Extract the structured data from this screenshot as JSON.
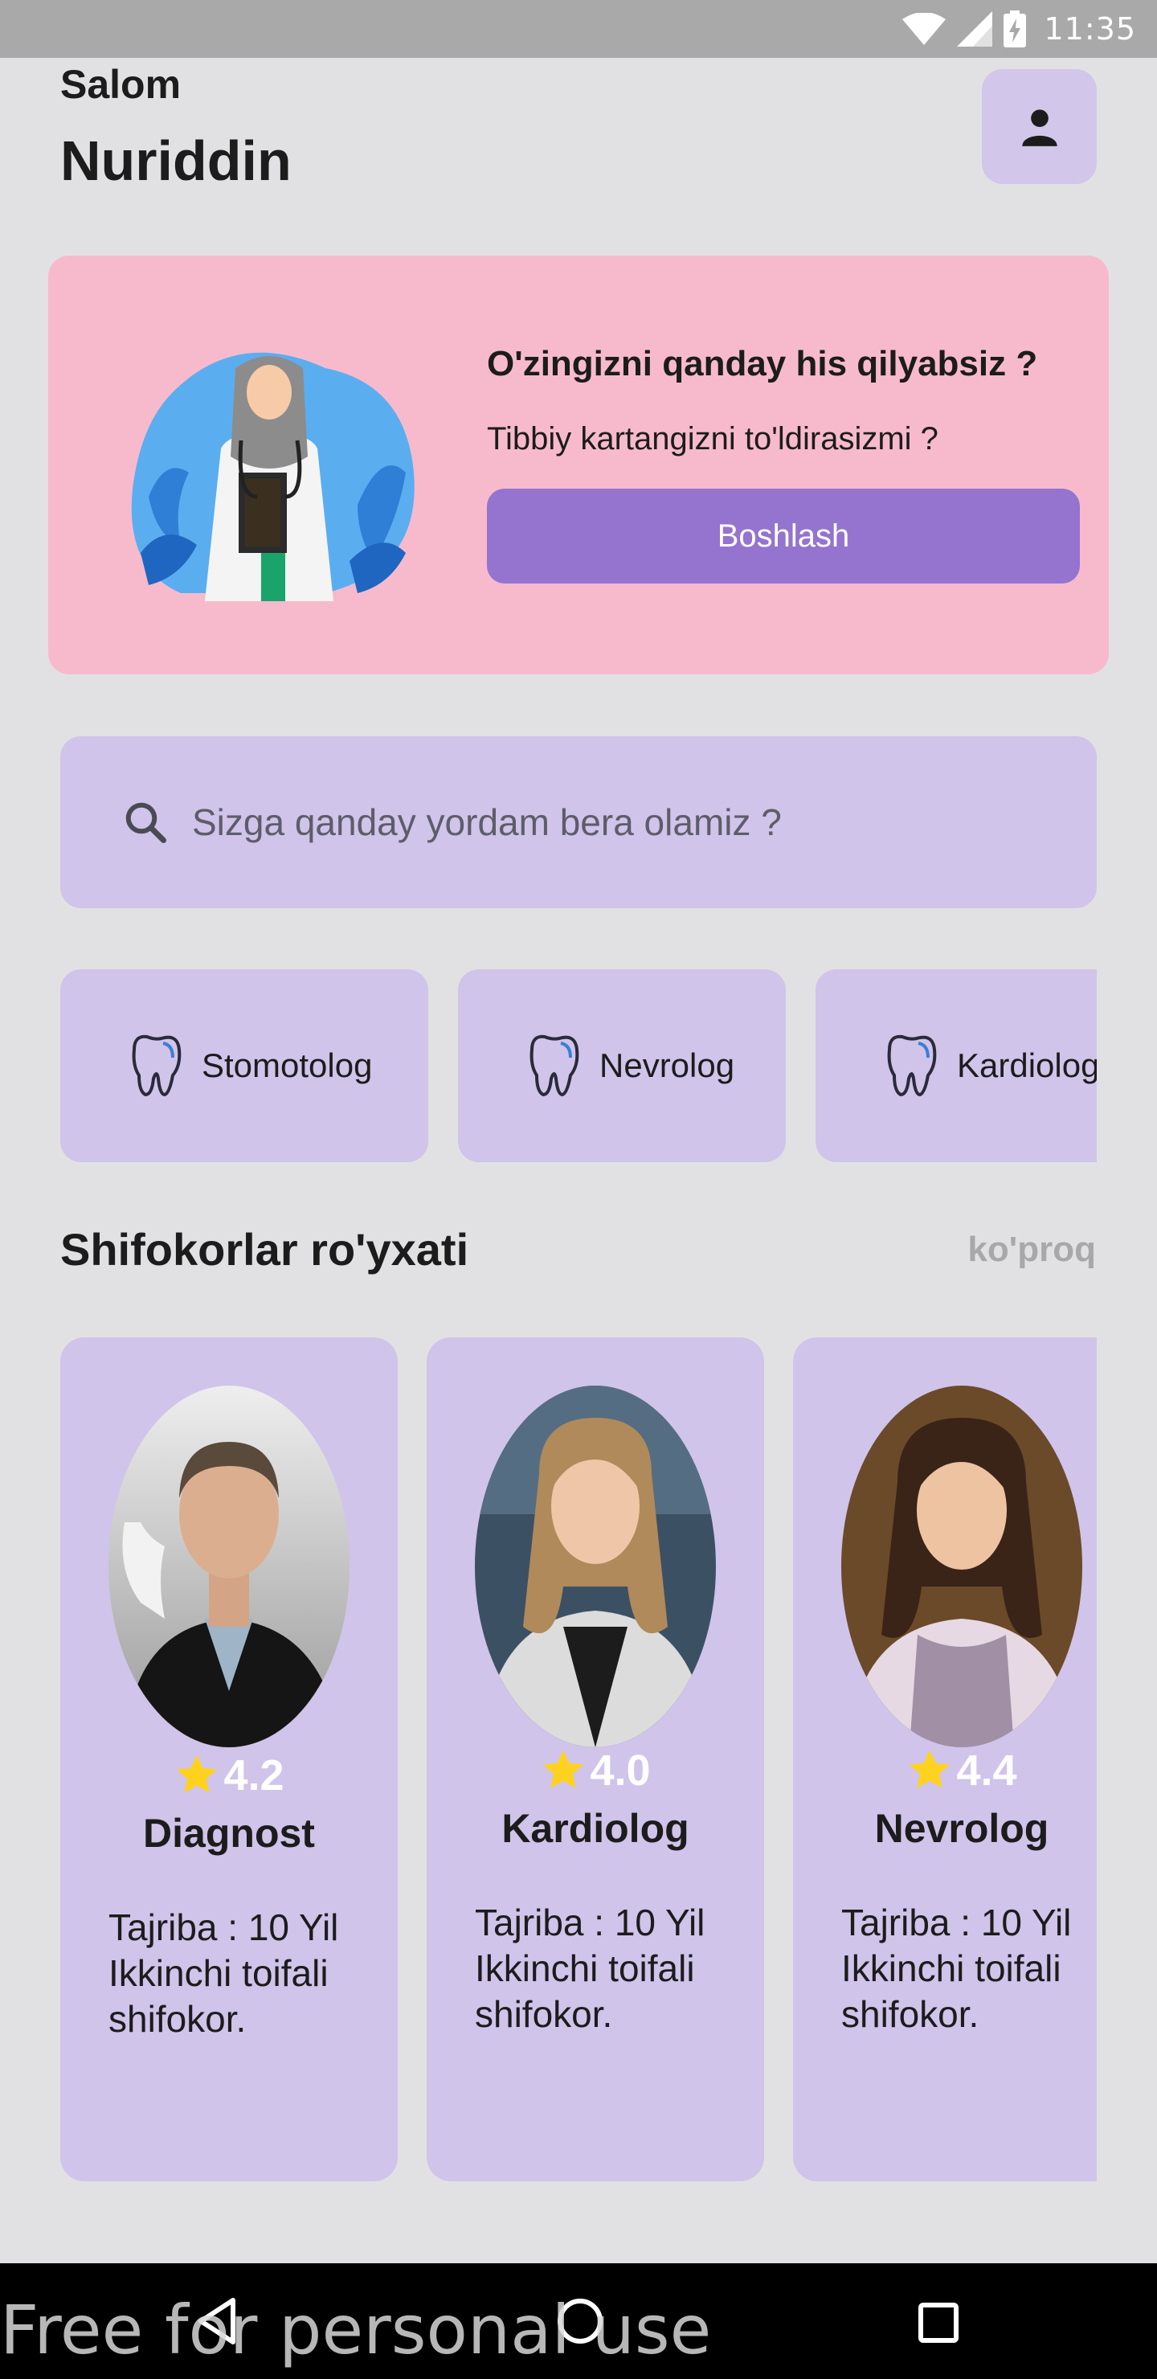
{
  "status_bar": {
    "time": "11:35",
    "icons": [
      "wifi-icon",
      "signal-icon",
      "battery-charging-icon"
    ]
  },
  "header": {
    "greeting": "Salom",
    "user_name": "Nuriddin",
    "profile_icon": "person-icon"
  },
  "promo": {
    "title": "O'zingizni qanday his qilyabsiz ?",
    "subtitle": "Tibbiy kartangizni to'ldirasizmi ?",
    "button_label": "Boshlash",
    "illustration": "doctor-illustration"
  },
  "search": {
    "placeholder": "Sizga qanday yordam bera olamiz ?",
    "value": ""
  },
  "categories": [
    {
      "label": "Stomotolog",
      "icon": "tooth-icon"
    },
    {
      "label": "Nevrolog",
      "icon": "tooth-icon"
    },
    {
      "label": "Kardiolog",
      "icon": "tooth-icon"
    }
  ],
  "doctors_section": {
    "title": "Shifokorlar ro'yxati",
    "more_label": "ko'proq"
  },
  "doctors": [
    {
      "rating": "4.2",
      "specialty": "Diagnost",
      "line1": "Tajriba : 10 Yil",
      "line2": "Ikkinchi toifali",
      "line3": "shifokor."
    },
    {
      "rating": "4.0",
      "specialty": "Kardiolog",
      "line1": "Tajriba : 10 Yil",
      "line2": "Ikkinchi toifali",
      "line3": "shifokor."
    },
    {
      "rating": "4.4",
      "specialty": "Nevrolog",
      "line1": "Tajriba : 10 Yil",
      "line2": "Ikkinchi toifali",
      "line3": "shifokor."
    }
  ],
  "nav_bar": {
    "icons": [
      "back-icon",
      "home-icon",
      "recents-icon"
    ]
  },
  "watermark": "Free for personal use",
  "colors": {
    "accent": "#9474cf",
    "card": "#d0c4ea",
    "promo": "#f7bacd",
    "star": "#ffd21f"
  }
}
